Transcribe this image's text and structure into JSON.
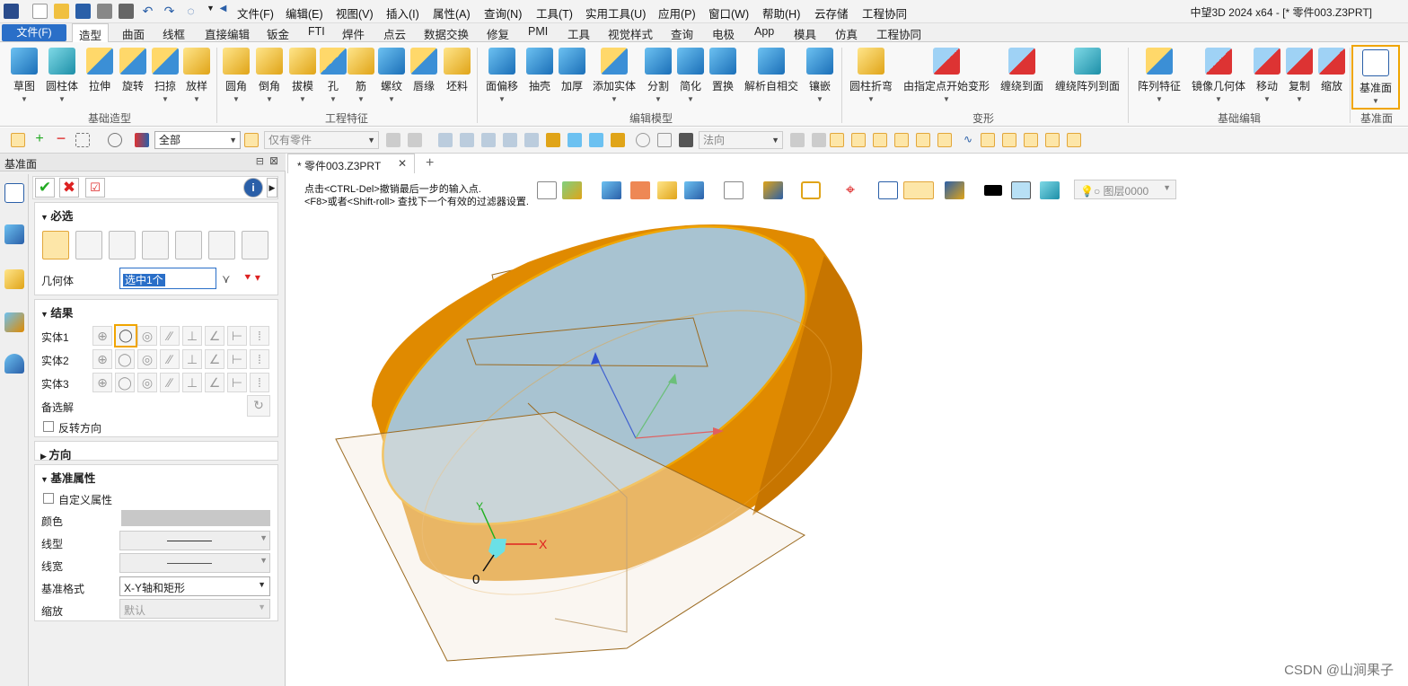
{
  "app": {
    "window_title": "中望3D 2024 x64 - [* 零件003.Z3PRT]"
  },
  "menu": [
    "文件(F)",
    "编辑(E)",
    "视图(V)",
    "插入(I)",
    "属性(A)",
    "查询(N)",
    "工具(T)",
    "实用工具(U)",
    "应用(P)",
    "窗口(W)",
    "帮助(H)",
    "云存储",
    "工程协同"
  ],
  "tabs": {
    "file": "文件(F)",
    "items": [
      "造型",
      "曲面",
      "线框",
      "直接编辑",
      "钣金",
      "FTI",
      "焊件",
      "点云",
      "数据交换",
      "修复",
      "PMI",
      "工具",
      "视觉样式",
      "查询",
      "电极",
      "App",
      "模具",
      "仿真",
      "工程协同"
    ]
  },
  "ribbon": {
    "buttons": [
      "草图",
      "圆柱体",
      "拉伸",
      "旋转",
      "扫掠",
      "放样",
      "圆角",
      "倒角",
      "拔模",
      "孔",
      "筋",
      "螺纹",
      "唇缘",
      "坯料",
      "面偏移",
      "抽壳",
      "加厚",
      "添加实体",
      "分割",
      "简化",
      "置换",
      "解析自相交",
      "镶嵌",
      "圆柱折弯",
      "由指定点开始变形",
      "缠绕到面",
      "缠绕阵列到面",
      "阵列特征",
      "镜像几何体",
      "移动",
      "复制",
      "缩放",
      "基准面"
    ],
    "groups": [
      "基础造型",
      "工程特征",
      "编辑模型",
      "变形",
      "基础编辑",
      "基准面"
    ]
  },
  "toolbar2": {
    "filter_all": "全部",
    "only_parts": "仅有零件",
    "normal": "法向"
  },
  "panel": {
    "title": "基准面",
    "required": "必选",
    "geometry_label": "几何体",
    "geometry_value": "选中1个",
    "result": "结果",
    "solids": [
      "实体1",
      "实体2",
      "实体3"
    ],
    "alternatives": "备选解",
    "reverse": "反转方向",
    "direction": "方向",
    "datum_props": "基准属性",
    "custom_props": "自定义属性",
    "color": "颜色",
    "linetype": "线型",
    "linewidth": "线宽",
    "datum_format_label": "基准格式",
    "datum_format_value": "X-Y轴和矩形",
    "scale_label": "缩放",
    "scale_value": "默认"
  },
  "document": {
    "tab": "* 零件003.Z3PRT"
  },
  "viewport": {
    "hint1": "点击<CTRL-Del>撤销最后一步的输入点.",
    "hint2": "<F8>或者<Shift-roll> 查找下一个有效的过滤器设置.",
    "layer": "图层0000",
    "axis_x": "X",
    "axis_y": "Y",
    "origin": "0",
    "watermark": "CSDN @山涧果子"
  },
  "colors": {
    "accent": "#2a6fc8",
    "highlight": "#f0a500",
    "solid": "#e08a00",
    "top_face": "#a8c3d1"
  }
}
